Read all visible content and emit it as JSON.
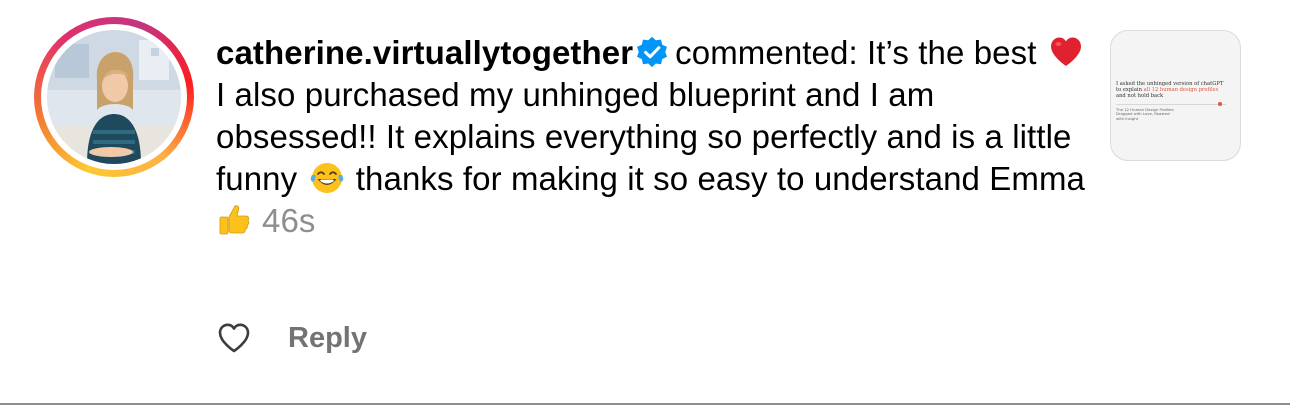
{
  "notification": {
    "username": "catherine.virtuallytogether",
    "verified": true,
    "action_text": "commented:",
    "comment_parts": [
      " It’s the best ",
      " I also purchased my unhinged blueprint and I am obsessed!! It explains everything so perfectly and is a little funny ",
      " thanks for making it so easy to understand Emma ",
      ""
    ],
    "emojis": [
      "red-heart",
      "face-with-tears-of-joy",
      "thumbs-up"
    ],
    "timestamp": "46s",
    "reply_label": "Reply",
    "like_icon": "heart-outline-icon"
  },
  "post_thumbnail": {
    "headline_start": "I asked the unhinged version of chatGPT to explain",
    "headline_accent": "all 12 human design profiles",
    "headline_end": "and not hold back",
    "subtext": "The 12 Human Design Profiles: Dragged with Love, Roasted with Insight"
  },
  "colors": {
    "text": "#000000",
    "secondary": "#8e8e8e",
    "reply": "#737373",
    "verified_badge": "#0095f6",
    "accent": "#e0573b"
  }
}
